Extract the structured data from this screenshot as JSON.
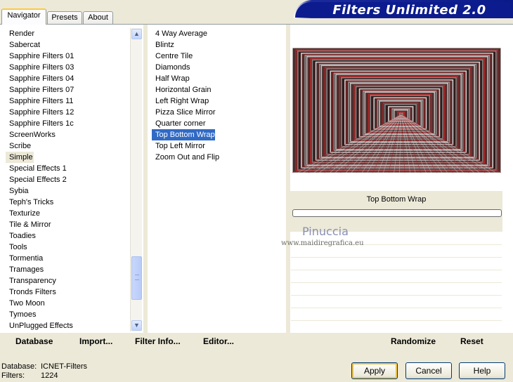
{
  "tabs": [
    {
      "label": "Navigator",
      "active": true
    },
    {
      "label": "Presets",
      "active": false
    },
    {
      "label": "About",
      "active": false
    }
  ],
  "title": "Filters Unlimited 2.0",
  "categories": [
    "Render",
    "Sabercat",
    "Sapphire Filters 01",
    "Sapphire Filters 03",
    "Sapphire Filters 04",
    "Sapphire Filters 07",
    "Sapphire Filters 11",
    "Sapphire Filters 12",
    "Sapphire Filters 1c",
    "ScreenWorks",
    "Scribe",
    "Simple",
    "Special Effects 1",
    "Special Effects 2",
    "Sybia",
    "Teph's Tricks",
    "Texturize",
    "Tile & Mirror",
    "Toadies",
    "Tools",
    "Tormentia",
    "Tramages",
    "Transparency",
    "Tronds Filters",
    "Two Moon",
    "Tymoes",
    "UnPlugged Effects"
  ],
  "selected_category": "Simple",
  "filters": [
    "4 Way Average",
    "Blintz",
    "Centre Tile",
    "Diamonds",
    "Half Wrap",
    "Horizontal Grain",
    "Left Right Wrap",
    "Pizza Slice Mirror",
    "Quarter corner",
    "Top Bottom Wrap",
    "Top Left Mirror",
    "Zoom Out and Flip"
  ],
  "selected_filter": "Top Bottom Wrap",
  "preview_label": "Top Bottom Wrap",
  "watermark": {
    "name": "Pinuccia",
    "url": "www.maidiregrafica.eu"
  },
  "toolbar": {
    "database": "Database",
    "import": "Import...",
    "filter_info": "Filter Info...",
    "editor": "Editor...",
    "randomize": "Randomize",
    "reset": "Reset"
  },
  "status": {
    "database_label": "Database:",
    "database_value": "ICNET-Filters",
    "filters_label": "Filters:",
    "filters_value": "1224"
  },
  "buttons": {
    "apply": "Apply",
    "cancel": "Cancel",
    "help": "Help"
  },
  "colors": {
    "selection": "#316ac5",
    "banner": "#0c1c8e",
    "panel": "#ece9d8"
  }
}
